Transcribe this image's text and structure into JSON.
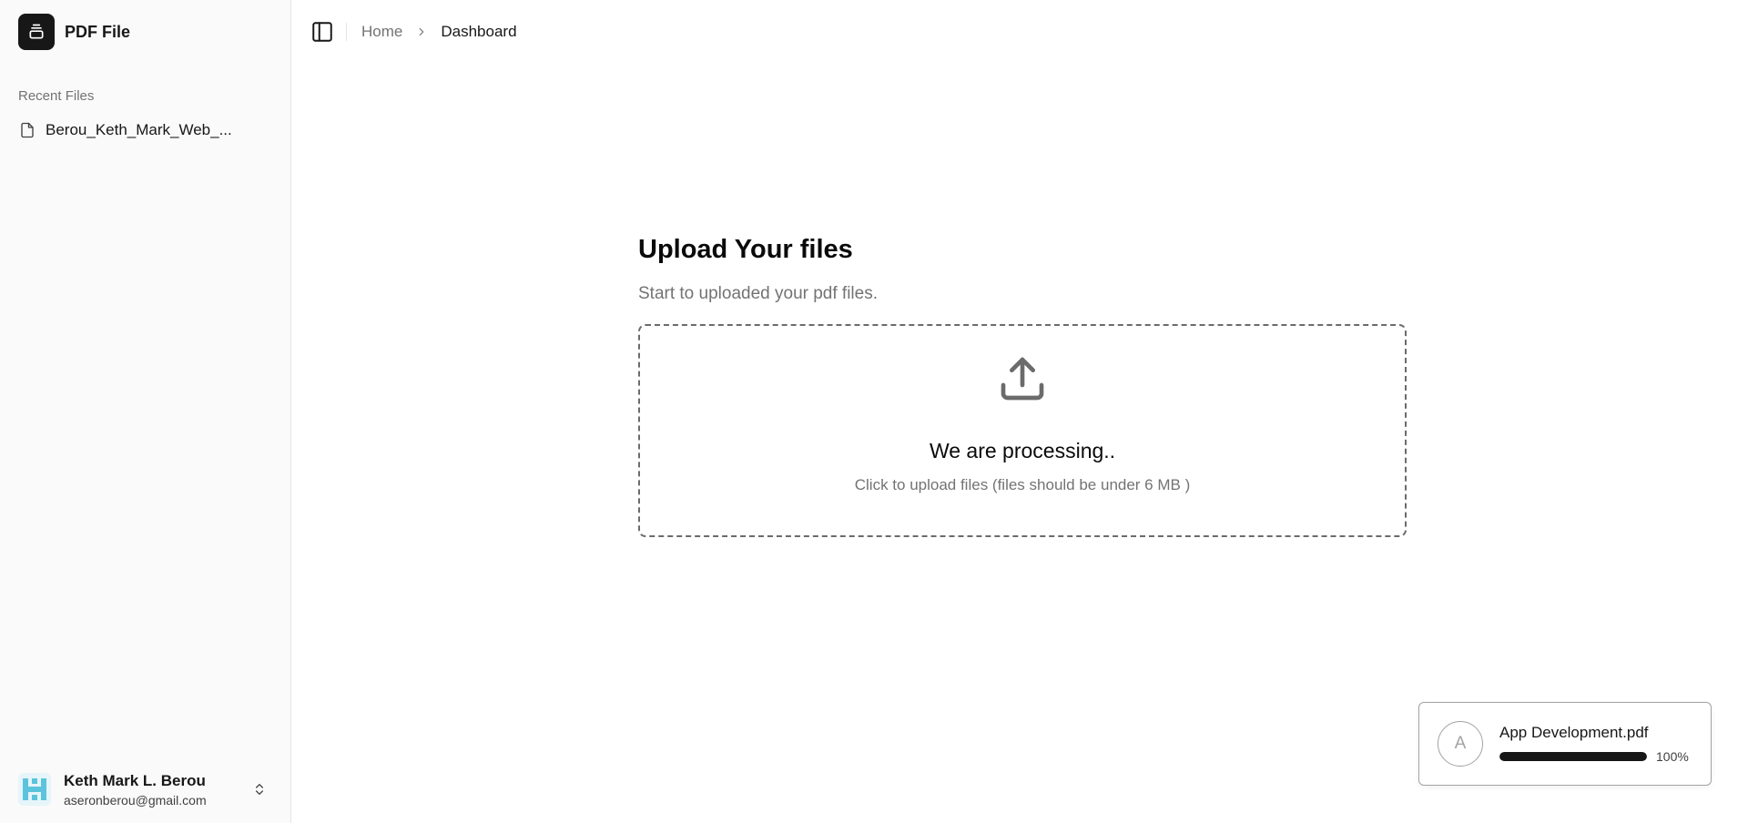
{
  "sidebar": {
    "brand": {
      "name": "PDF File",
      "icon": "stack-icon"
    },
    "recent_label": "Recent Files",
    "recent_files": [
      {
        "label": "Berou_Keth_Mark_Web_...",
        "icon": "file-icon"
      }
    ],
    "user": {
      "name": "Keth Mark L. Berou",
      "email": "aseronberou@gmail.com",
      "toggle_icon": "chevrons-up-down-icon"
    }
  },
  "topbar": {
    "toggle_icon": "panel-left-icon",
    "breadcrumb": {
      "home": "Home",
      "current": "Dashboard"
    }
  },
  "upload": {
    "title": "Upload Your files",
    "subtitle": "Start to uploaded your pdf files.",
    "status": "We are processing..",
    "hint": "Click to upload files (files should be under 6 MB )",
    "icon": "upload-icon"
  },
  "toast": {
    "avatar_letter": "A",
    "file_name": "App Development.pdf",
    "progress": 1.0,
    "progress_label": "100%"
  },
  "colors": {
    "sidebar_bg": "#fafafa",
    "brand_bg": "#171717",
    "muted_text": "#737373",
    "progress_fill": "#171717",
    "avatar_bg": "#e6f5fa"
  }
}
